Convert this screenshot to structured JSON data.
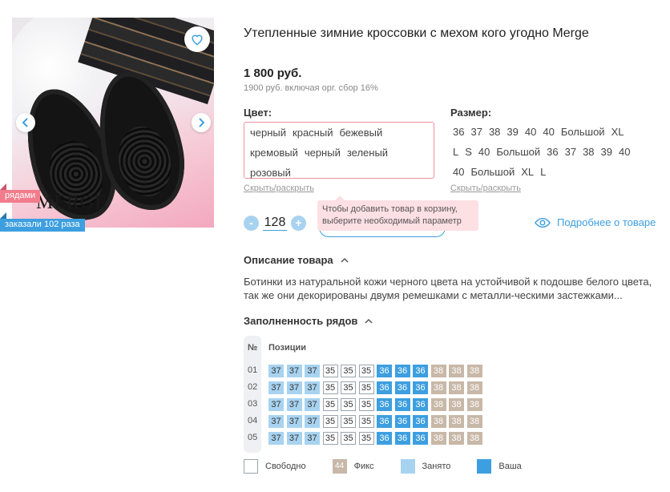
{
  "product": {
    "title": "Утепленные зимние кроссовки с мехом кого угодно Merge",
    "price": "1 800 руб.",
    "price_note": "1900 руб. включая орг. сбор 16%",
    "photo_brand_text": "MERGE"
  },
  "badges": {
    "rows": "рядами",
    "ordered": "заказали 102 раза"
  },
  "color": {
    "label": "Цвет:",
    "options": [
      "черный",
      "красный",
      "бежевый",
      "кремовый",
      "черный",
      "зеленый",
      "розовый"
    ],
    "toggle": "Скрыть/раскрыть"
  },
  "size": {
    "label": "Размер:",
    "options": [
      "36",
      "37",
      "38",
      "39",
      "40",
      "40",
      "Большой",
      "XL",
      "L",
      "S",
      "40",
      "Большой",
      "36",
      "37",
      "38",
      "39",
      "40",
      "40",
      "Большой",
      "XL",
      "L"
    ],
    "toggle": "Скрыть/раскрыть"
  },
  "tooltip": "Чтобы добавить товар в корзину, выберите необходимый параметр",
  "quantity": {
    "minus": "-",
    "value": "128",
    "plus": "+"
  },
  "more_link": "Подробнее о товаре",
  "description": {
    "heading": "Описание товара",
    "text": "Ботинки из натуральной кожи черного цвета на устойчивой к подошве белого цвета, так же они декорированы двумя ремешками с металли-ческими застежками..."
  },
  "rows_fill": {
    "heading": "Заполненность рядов",
    "col_no": "№",
    "col_positions": "Позиции",
    "rows": [
      {
        "no": "01",
        "cells": [
          [
            "37",
            "busy"
          ],
          [
            "37",
            "busy"
          ],
          [
            "37",
            "busy"
          ],
          [
            "35",
            "free"
          ],
          [
            "35",
            "free"
          ],
          [
            "35",
            "free"
          ],
          [
            "36",
            "yours"
          ],
          [
            "36",
            "yours"
          ],
          [
            "36",
            "yours"
          ],
          [
            "38",
            "fix"
          ],
          [
            "38",
            "fix"
          ],
          [
            "38",
            "fix"
          ]
        ]
      },
      {
        "no": "02",
        "cells": [
          [
            "37",
            "busy"
          ],
          [
            "37",
            "busy"
          ],
          [
            "37",
            "busy"
          ],
          [
            "35",
            "free"
          ],
          [
            "35",
            "free"
          ],
          [
            "35",
            "free"
          ],
          [
            "36",
            "yours"
          ],
          [
            "36",
            "yours"
          ],
          [
            "36",
            "yours"
          ],
          [
            "38",
            "fix"
          ],
          [
            "38",
            "fix"
          ],
          [
            "38",
            "fix"
          ]
        ]
      },
      {
        "no": "03",
        "cells": [
          [
            "37",
            "busy"
          ],
          [
            "37",
            "busy"
          ],
          [
            "37",
            "busy"
          ],
          [
            "35",
            "free"
          ],
          [
            "35",
            "free"
          ],
          [
            "35",
            "free"
          ],
          [
            "36",
            "yours"
          ],
          [
            "36",
            "yours"
          ],
          [
            "36",
            "yours"
          ],
          [
            "38",
            "fix"
          ],
          [
            "38",
            "fix"
          ],
          [
            "38",
            "fix"
          ]
        ]
      },
      {
        "no": "04",
        "cells": [
          [
            "37",
            "busy"
          ],
          [
            "37",
            "busy"
          ],
          [
            "37",
            "busy"
          ],
          [
            "35",
            "free"
          ],
          [
            "35",
            "free"
          ],
          [
            "35",
            "free"
          ],
          [
            "36",
            "yours"
          ],
          [
            "36",
            "yours"
          ],
          [
            "36",
            "yours"
          ],
          [
            "38",
            "fix"
          ],
          [
            "38",
            "fix"
          ],
          [
            "38",
            "fix"
          ]
        ]
      },
      {
        "no": "05",
        "cells": [
          [
            "37",
            "busy"
          ],
          [
            "37",
            "busy"
          ],
          [
            "37",
            "busy"
          ],
          [
            "35",
            "free"
          ],
          [
            "35",
            "free"
          ],
          [
            "35",
            "free"
          ],
          [
            "36",
            "yours"
          ],
          [
            "36",
            "yours"
          ],
          [
            "36",
            "yours"
          ],
          [
            "38",
            "fix"
          ],
          [
            "38",
            "fix"
          ],
          [
            "38",
            "fix"
          ]
        ]
      }
    ]
  },
  "legend": {
    "free": "Свободно",
    "fix_value": "44",
    "fix": "Фикс",
    "busy": "Занято",
    "yours": "Ваша"
  },
  "colors": {
    "accent": "#3d9fe0",
    "busy": "#a8d3f0",
    "fix": "#c8b8a8",
    "error_border": "#f0909c",
    "tooltip_bg": "#fde0e4",
    "badge_rows": "#f27c8c"
  }
}
